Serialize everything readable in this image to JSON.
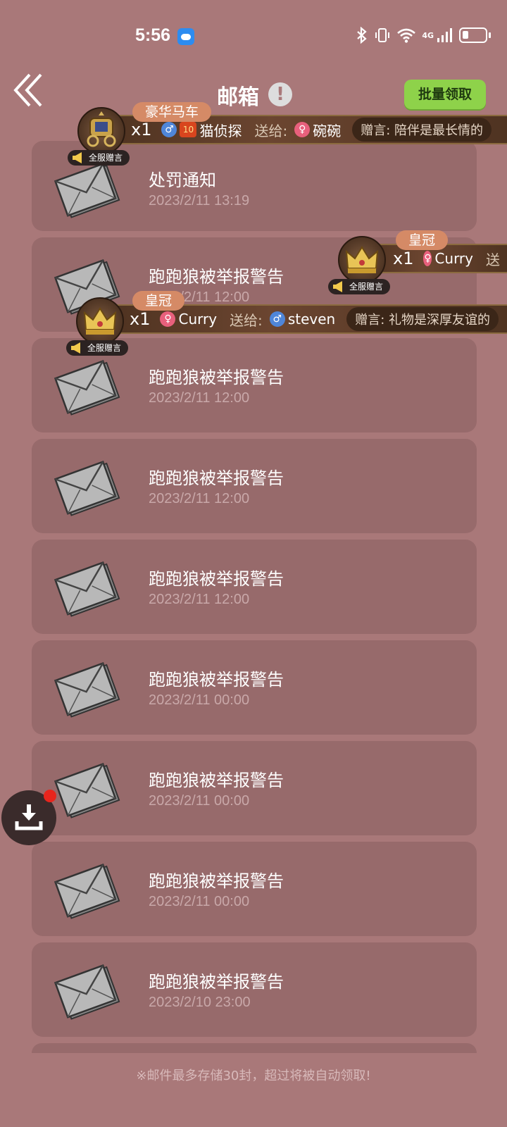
{
  "status_bar": {
    "time": "5:56",
    "network": "4G",
    "app_icon": "weather-icon"
  },
  "header": {
    "title": "邮箱",
    "help_icon": "!",
    "batch_button": "批量领取"
  },
  "mails": [
    {
      "title": "处罚通知",
      "time": "2023/2/11  13:19"
    },
    {
      "title": "跑跑狼被举报警告",
      "time": "2023/2/11  12:00"
    },
    {
      "title": "跑跑狼被举报警告",
      "time": "2023/2/11  12:00"
    },
    {
      "title": "跑跑狼被举报警告",
      "time": "2023/2/11  12:00"
    },
    {
      "title": "跑跑狼被举报警告",
      "time": "2023/2/11  12:00"
    },
    {
      "title": "跑跑狼被举报警告",
      "time": "2023/2/11  00:00"
    },
    {
      "title": "跑跑狼被举报警告",
      "time": "2023/2/11  00:00"
    },
    {
      "title": "跑跑狼被举报警告",
      "time": "2023/2/11  00:00"
    },
    {
      "title": "跑跑狼被举报警告",
      "time": "2023/2/10  23:00"
    }
  ],
  "footer_note": "※邮件最多存储30封，超过将被自动领取!",
  "gift_banners": [
    {
      "gift_name": "豪华马车",
      "qty": "x1",
      "level": "10",
      "sender": "猫侦探",
      "sent_to_label": "送给:",
      "receiver": "碗碗",
      "note_label": "赠言:",
      "note": "陪伴是最长情的",
      "server_tag": "全服赠言"
    },
    {
      "gift_name": "皇冠",
      "qty": "x1",
      "sender": "Curry",
      "sent_to_label": "送",
      "server_tag": "全服赠言"
    },
    {
      "gift_name": "皇冠",
      "qty": "x1",
      "sender": "Curry",
      "sent_to_label": "送给:",
      "receiver": "steven",
      "note_label": "赠言:",
      "note": "礼物是深厚友谊的",
      "server_tag": "全服赠言"
    }
  ],
  "colors": {
    "background": "#a97879",
    "card": "#976a6b",
    "batch_button": "#8ed24a",
    "notification_dot": "#e8251d"
  }
}
